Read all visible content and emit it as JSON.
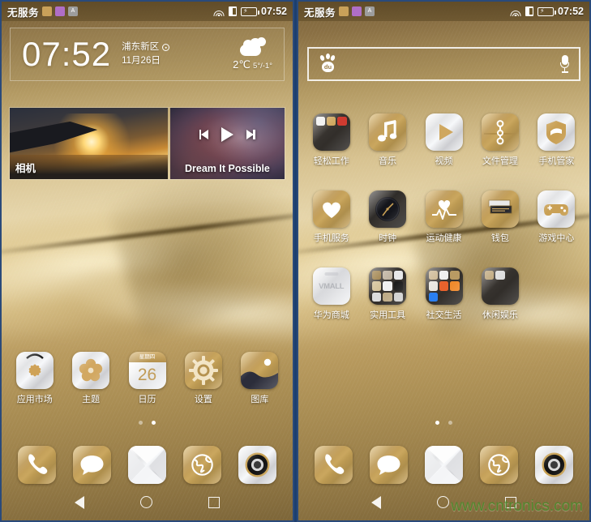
{
  "statusbar": {
    "carrier": "无服务",
    "time": "07:52",
    "icons": [
      "sim-card-icon",
      "sync-icon",
      "input-method-icon",
      "wifi-icon",
      "signal-icon",
      "battery-charging-icon"
    ]
  },
  "left_screen": {
    "clock_widget": {
      "time": "07:52",
      "location": "浦东新区",
      "date": "11月26日",
      "temperature": "2℃",
      "range": "5°/-1°",
      "weather_icon": "partly-cloudy-icon"
    },
    "camera_widget": {
      "label": "相机"
    },
    "music_widget": {
      "title": "Dream It Possible",
      "prev_label": "prev-track",
      "play_label": "play",
      "next_label": "next-track"
    },
    "apps": [
      {
        "label": "应用市场",
        "icon": "huawei-appgallery-icon",
        "style": "silver"
      },
      {
        "label": "主题",
        "icon": "themes-icon",
        "style": "silver"
      },
      {
        "label": "日历",
        "icon": "calendar-icon",
        "style": "calendar",
        "weekday": "星期四",
        "day": "26"
      },
      {
        "label": "设置",
        "icon": "gear-icon",
        "style": "gold"
      },
      {
        "label": "图库",
        "icon": "gallery-icon",
        "style": "gold"
      }
    ],
    "page_dots": {
      "count": 2,
      "active": 1
    }
  },
  "right_screen": {
    "search": {
      "engine": "baidu",
      "logo_text": "du",
      "placeholder": "",
      "value": "",
      "mic_label": "voice-search"
    },
    "apps_row1": [
      {
        "label": "轻松工作",
        "icon": "folder-icon",
        "style": "folder-dark"
      },
      {
        "label": "音乐",
        "icon": "music-note-icon",
        "style": "gold"
      },
      {
        "label": "视频",
        "icon": "play-triangle-icon",
        "style": "silver"
      },
      {
        "label": "文件管理",
        "icon": "file-manager-icon",
        "style": "gold"
      },
      {
        "label": "手机管家",
        "icon": "shield-icon",
        "style": "silver"
      }
    ],
    "apps_row2": [
      {
        "label": "手机服务",
        "icon": "heart-icon",
        "style": "gold"
      },
      {
        "label": "时钟",
        "icon": "clock-icon",
        "style": "dark"
      },
      {
        "label": "运动健康",
        "icon": "health-heartbeat-icon",
        "style": "gold"
      },
      {
        "label": "钱包",
        "icon": "wallet-icon",
        "style": "gold"
      },
      {
        "label": "游戏中心",
        "icon": "gamepad-icon",
        "style": "silver"
      }
    ],
    "apps_row3": [
      {
        "label": "华为商城",
        "icon": "vmall-icon",
        "style": "vmall",
        "logo_text": "VMALL"
      },
      {
        "label": "实用工具",
        "icon": "folder-icon",
        "style": "folder-dark"
      },
      {
        "label": "社交生活",
        "icon": "folder-icon",
        "style": "folder-dark"
      },
      {
        "label": "休闲娱乐",
        "icon": "folder-icon",
        "style": "folder-dark"
      }
    ],
    "page_dots": {
      "count": 2,
      "active": 0
    }
  },
  "dock": [
    {
      "label": "phone-app",
      "icon": "phone-handset-icon",
      "style": "gold"
    },
    {
      "label": "messages-app",
      "icon": "chat-bubble-icon",
      "style": "gold"
    },
    {
      "label": "email-app",
      "icon": "envelope-icon",
      "style": "silver"
    },
    {
      "label": "browser-app",
      "icon": "globe-icon",
      "style": "gold"
    },
    {
      "label": "camera-app",
      "icon": "camera-lens-icon",
      "style": "silver"
    }
  ],
  "navbar": {
    "back": "back-icon",
    "home": "home-icon",
    "recents": "recents-icon"
  },
  "watermark": "www.cntronics.com",
  "colors": {
    "accent_gold": "#c9a763",
    "bg_blue": "#1d3f6e",
    "watermark_green": "#4a8b2b"
  }
}
